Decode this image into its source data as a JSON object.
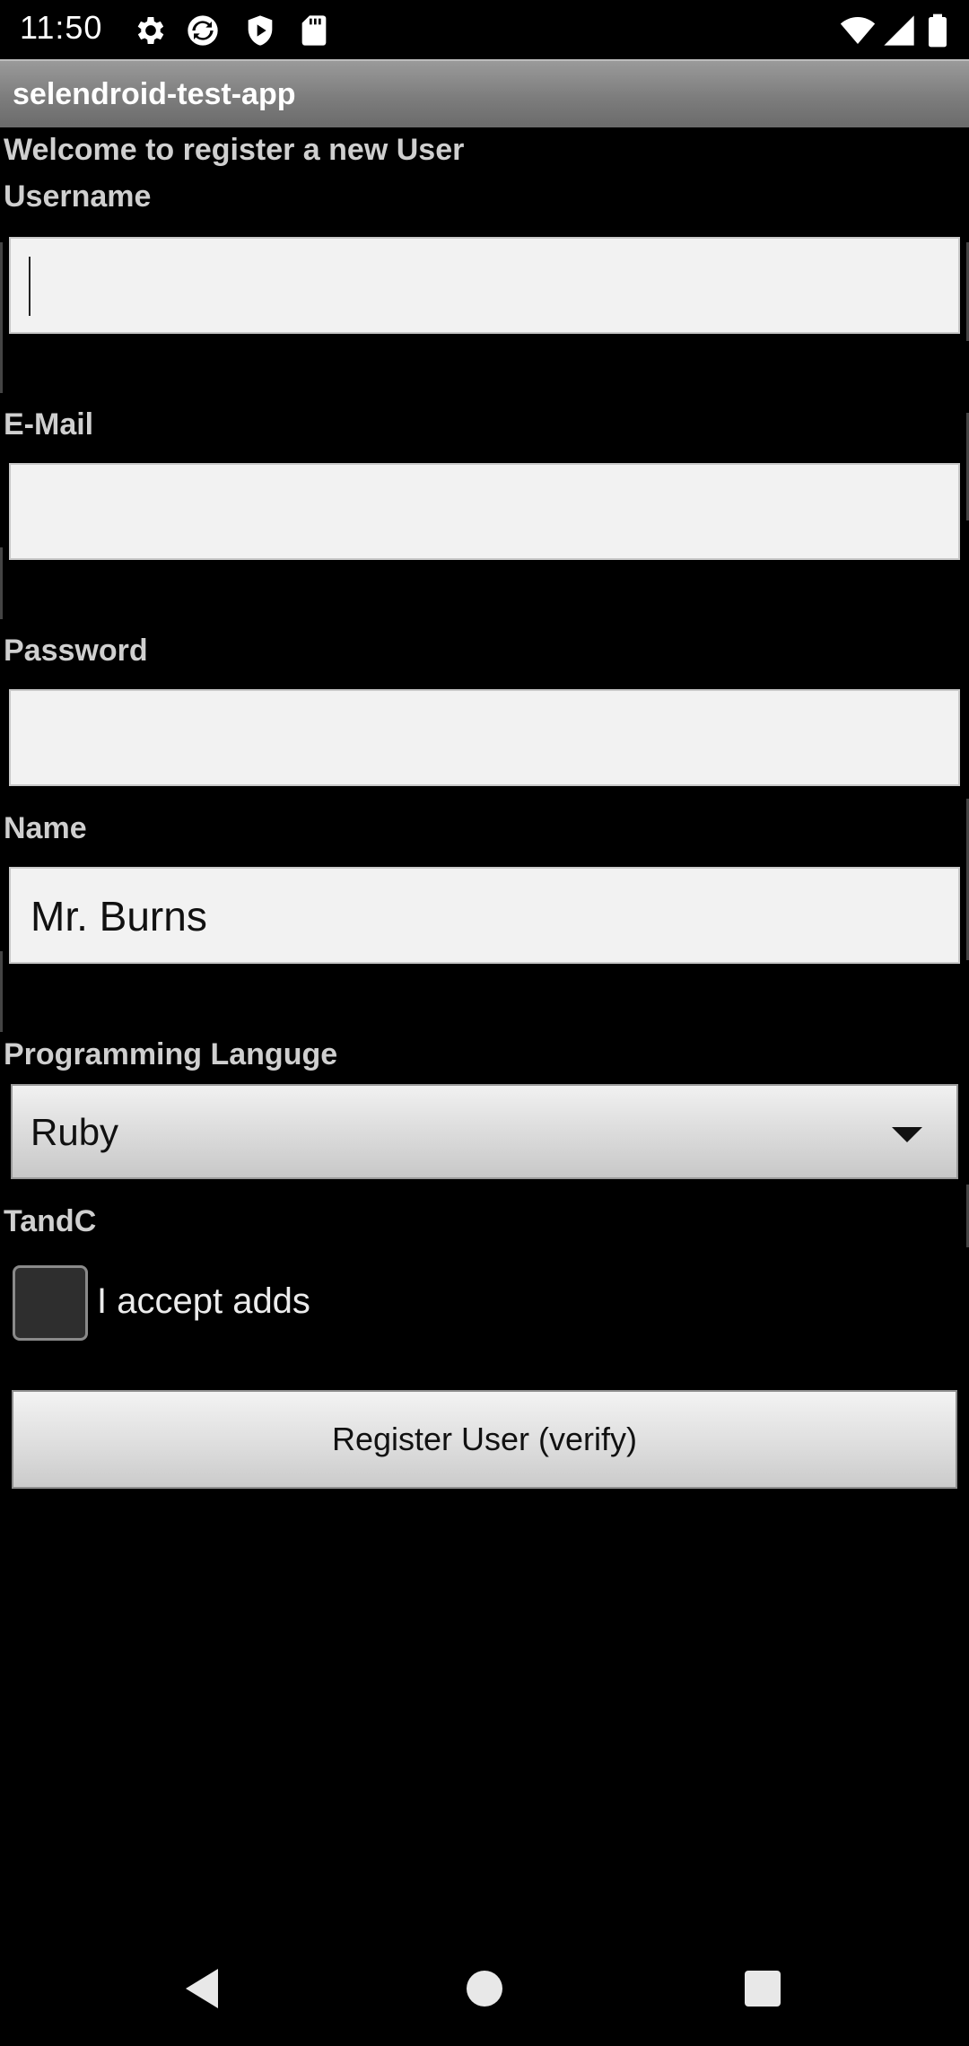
{
  "status_bar": {
    "time": "11:50",
    "left_icons": [
      "gear-icon",
      "sync-icon",
      "shield-icon",
      "sd-card-icon"
    ],
    "right_icons": [
      "wifi-icon",
      "cell-signal-icon",
      "battery-icon"
    ]
  },
  "app": {
    "title": "selendroid-test-app"
  },
  "form": {
    "welcome": "Welcome to register a new User",
    "username_label": "Username",
    "username_value": "",
    "email_label": "E-Mail",
    "email_value": "",
    "password_label": "Password",
    "password_value": "",
    "name_label": "Name",
    "name_value": "Mr. Burns",
    "language_label": "Programming Languge",
    "language_value": "Ruby",
    "tandc_label": "TandC",
    "accept_label": "I accept adds",
    "accept_checked": false,
    "register_label": "Register User (verify)"
  },
  "nav_bar": {
    "icons": [
      "back-icon",
      "home-icon",
      "recents-icon"
    ]
  },
  "colors": {
    "background": "#000000",
    "title_bar": "#7d7d7d",
    "field_bg": "#f2f2f2",
    "label_text": "#cfcfcf"
  }
}
